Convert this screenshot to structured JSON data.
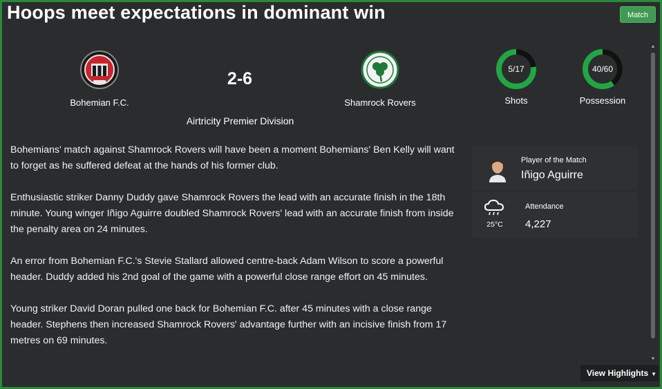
{
  "header": {
    "title": "Hoops meet expectations in dominant win",
    "match_button": "Match"
  },
  "match": {
    "home_team": "Bohemian F.C.",
    "away_team": "Shamrock Rovers",
    "score": "2-6",
    "competition": "Airtricity Premier Division"
  },
  "stats": {
    "shots": {
      "label": "Shots",
      "value": "5/17",
      "fraction": 0.23
    },
    "possession": {
      "label": "Possession",
      "value": "40/60",
      "fraction": 0.4
    },
    "ring_colors": {
      "home": "#111111",
      "away": "#22a545"
    }
  },
  "report": {
    "paragraphs": [
      "Bohemians' match against Shamrock Rovers will have been a moment Bohemians' Ben Kelly will want to forget as he suffered defeat at the hands of his former club.",
      "Enthusiastic striker Danny Duddy gave Shamrock Rovers the lead with an accurate finish in the 18th minute. Young winger Iñigo Aguirre doubled Shamrock Rovers' lead with an accurate finish from inside the penalty area on 24 minutes.",
      "An error from Bohemian F.C.'s Stevie Stallard allowed centre-back Adam Wilson to score a powerful header. Duddy added his 2nd goal of the game with a powerful close range effort on 45 minutes.",
      "Young striker David Doran pulled one back for Bohemian F.C. after 45 minutes with a close range header. Stephens then increased Shamrock Rovers' advantage further with an incisive finish from 17 metres on 69 minutes."
    ]
  },
  "side": {
    "potm_title": "Player of the Match",
    "potm_name": "Iñigo Aguirre",
    "weather_icon": "rain-cloud-icon",
    "temperature": "25°C",
    "attendance_title": "Attendance",
    "attendance_value": "4,227"
  },
  "footer": {
    "highlights_label": "View Highlights"
  },
  "colors": {
    "accent": "#3f9a52",
    "frame": "#2a8a3a",
    "background": "#2b2c2e"
  }
}
